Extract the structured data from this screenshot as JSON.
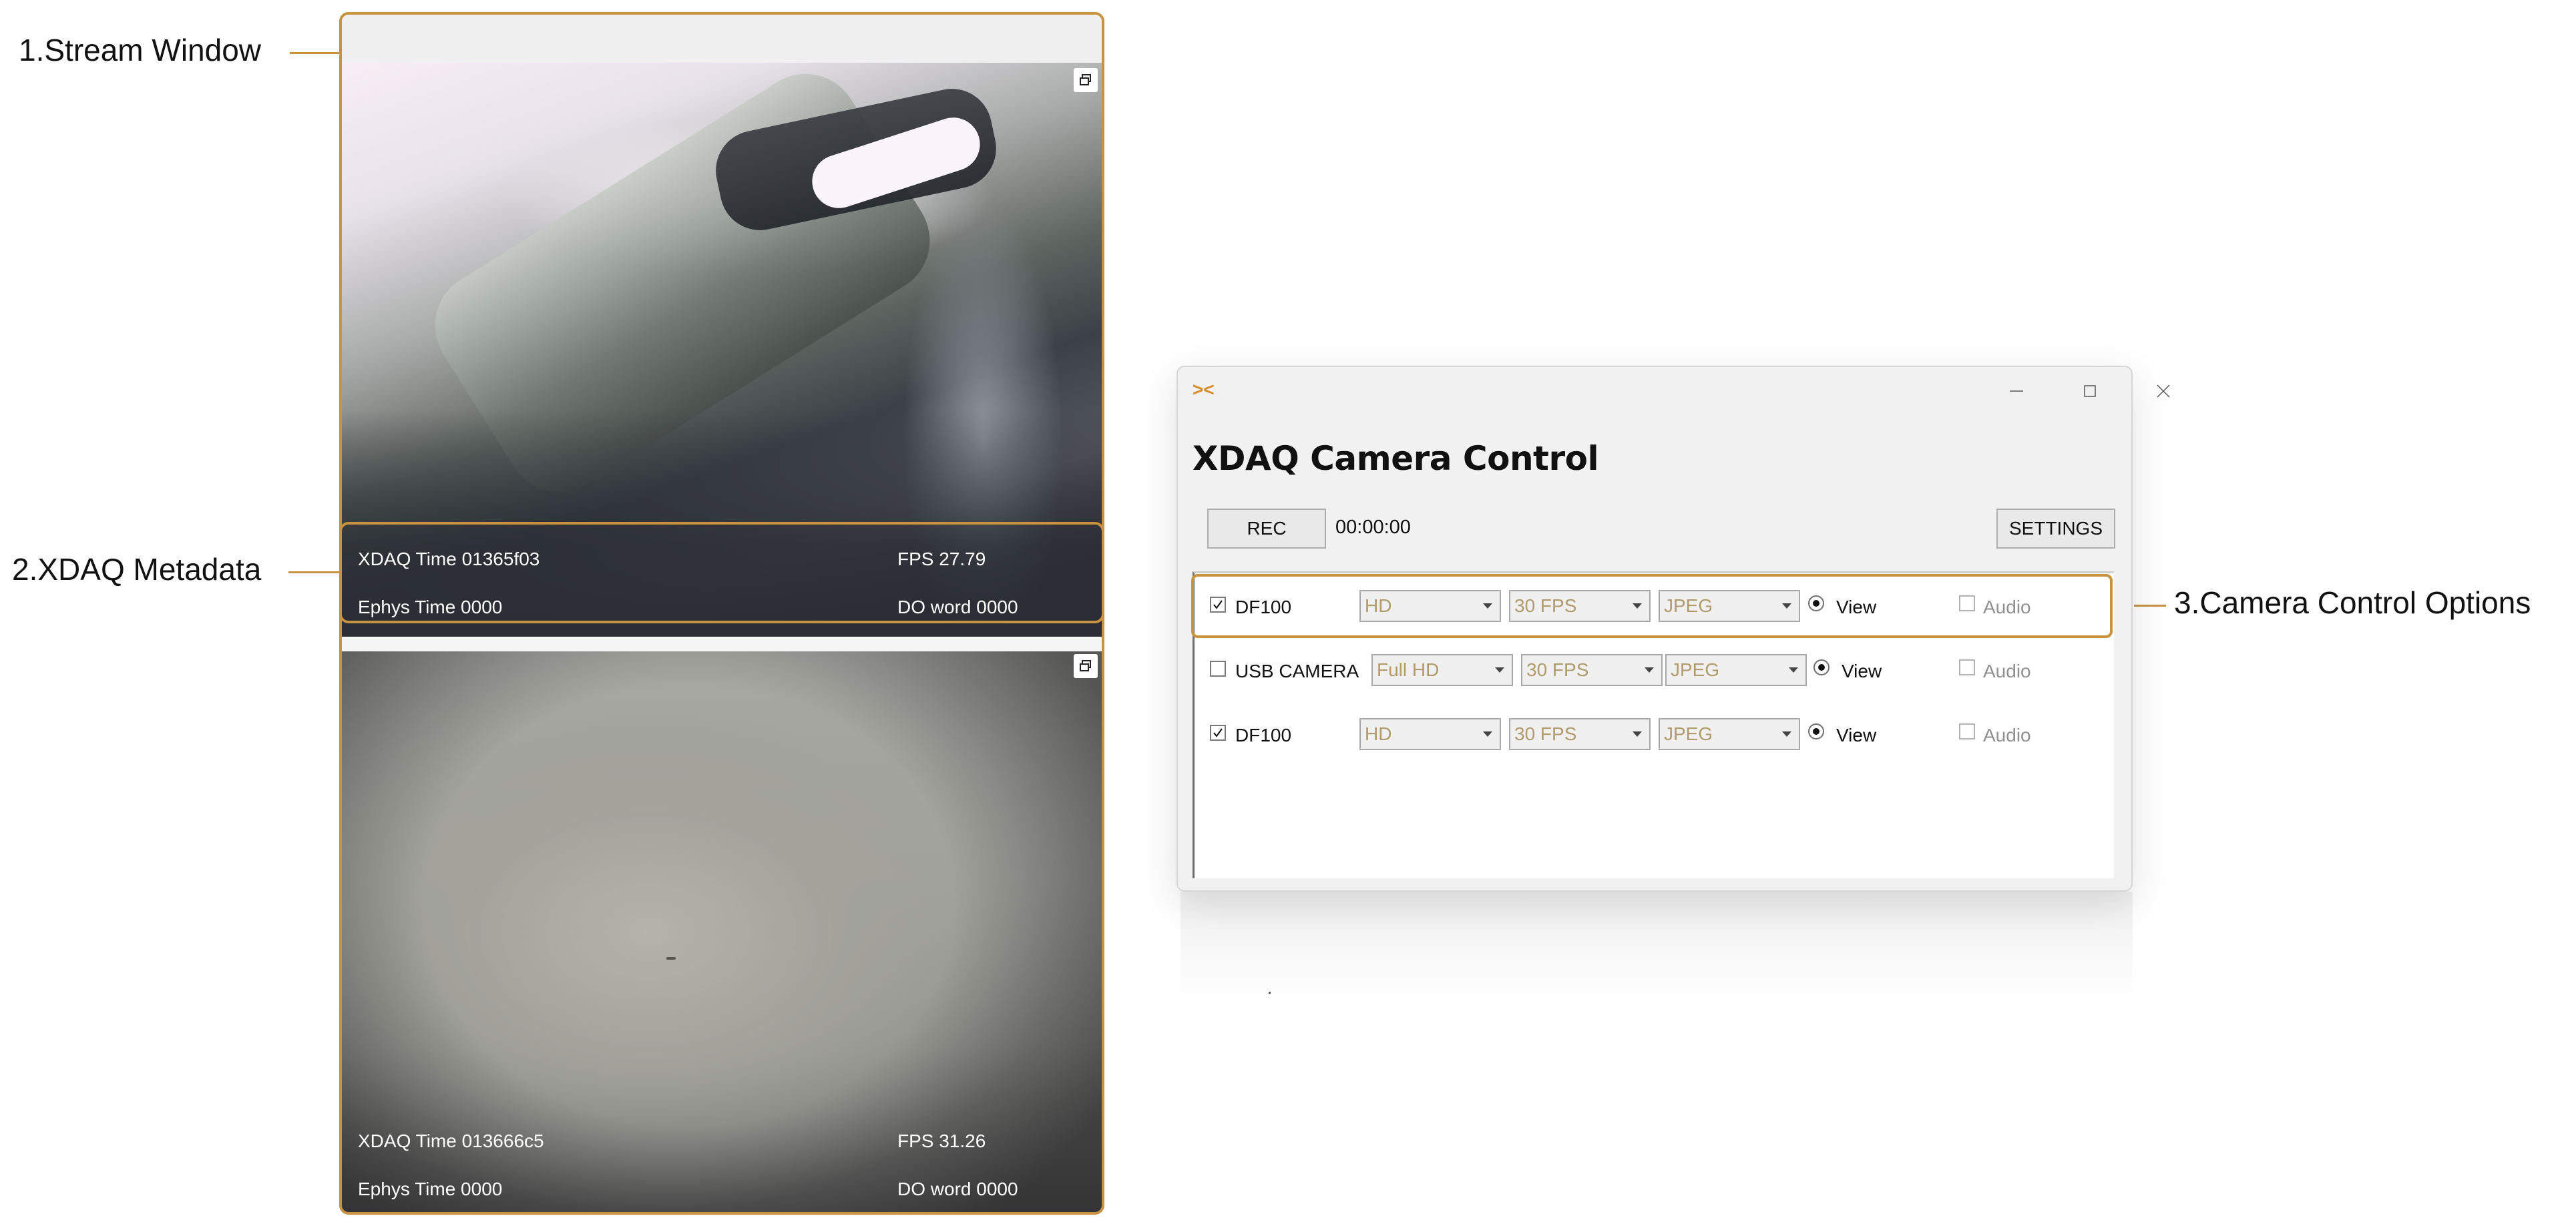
{
  "annotations": {
    "stream_window": "1.Stream Window",
    "xdaq_metadata": "2.XDAQ Metadata",
    "camera_control_options": "3.Camera Control Options",
    "highlight_color": "#c8923f"
  },
  "streams": [
    {
      "xdaq_time": "XDAQ Time 01365f03",
      "fps": "FPS 27.79",
      "ephys_time": "Ephys Time 0000",
      "do_word": "DO word 0000"
    },
    {
      "xdaq_time": "XDAQ Time 013666c5",
      "fps": "FPS 31.26",
      "ephys_time": "Ephys Time 0000",
      "do_word": "DO word 0000"
    }
  ],
  "camera_control": {
    "app_icon": "><",
    "title": "XDAQ Camera Control",
    "rec_label": "REC",
    "timer": "00:00:00",
    "settings_label": "SETTINGS",
    "window_controls": [
      "minimize-icon",
      "maximize-icon",
      "close-icon"
    ],
    "cameras": [
      {
        "checked": true,
        "name": "DF100",
        "resolution": "HD",
        "fps": "30 FPS",
        "format": "JPEG",
        "view_label": "View",
        "view_selected": true,
        "audio_label": "Audio",
        "audio_checked": false
      },
      {
        "checked": false,
        "name": "USB CAMERA",
        "resolution": "Full HD",
        "fps": "30 FPS",
        "format": "JPEG",
        "view_label": "View",
        "view_selected": true,
        "audio_label": "Audio",
        "audio_checked": false
      },
      {
        "checked": true,
        "name": "DF100",
        "resolution": "HD",
        "fps": "30 FPS",
        "format": "JPEG",
        "view_label": "View",
        "view_selected": true,
        "audio_label": "Audio",
        "audio_checked": false
      }
    ]
  }
}
